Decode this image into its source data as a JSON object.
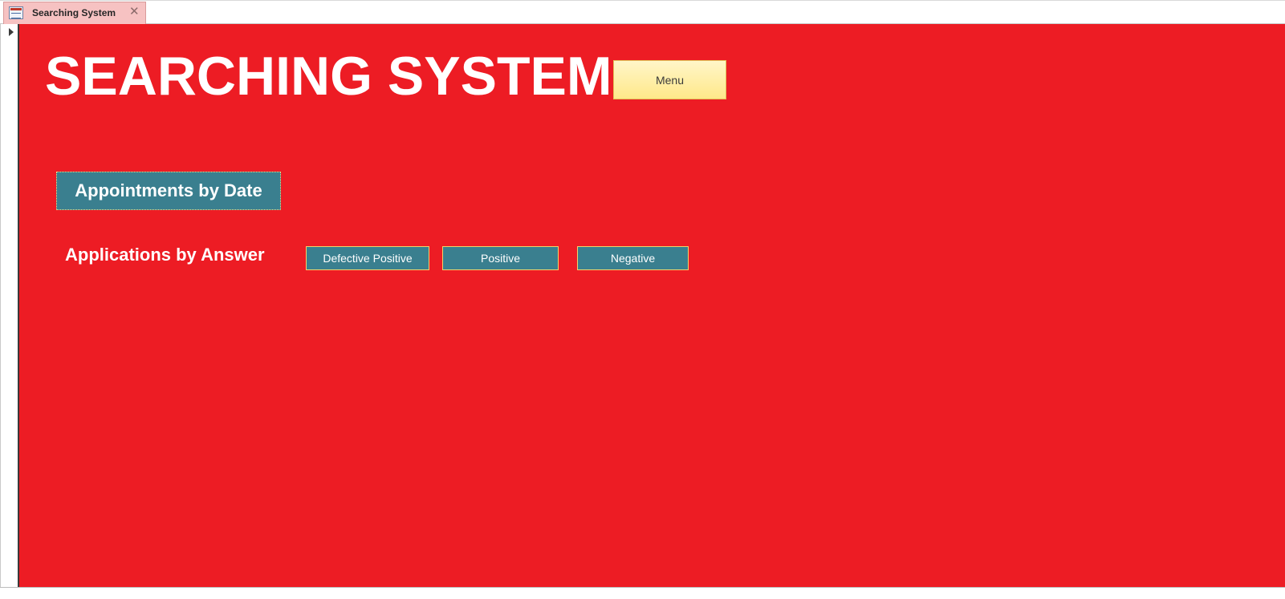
{
  "tab": {
    "title": "Searching System",
    "icon": "form-icon",
    "close_icon": "close-icon"
  },
  "form": {
    "title": "SEARCHING SYSTEM",
    "background_color": "#ed1c24",
    "menu_label": "Menu",
    "appointments_label": "Appointments by Date",
    "answer_section_label": "Applications by Answer",
    "answer_buttons": [
      {
        "label": "Defective Positive"
      },
      {
        "label": "Positive"
      },
      {
        "label": "Negative"
      }
    ],
    "button_color": "#3a7f8f",
    "menu_button_color": "#fff0a8"
  },
  "record_selector": {
    "icon": "current-record-arrow-icon"
  }
}
